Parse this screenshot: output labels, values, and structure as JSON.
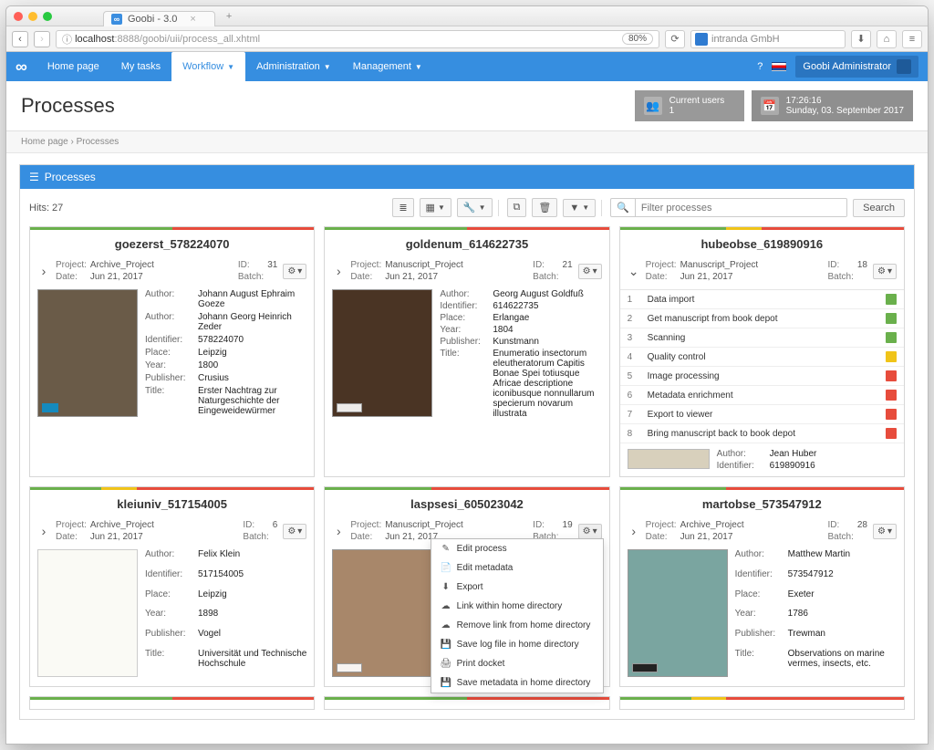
{
  "window": {
    "tab_title": "Goobi - 3.0",
    "url_host": "localhost",
    "url_port": ":8888",
    "url_path": "/goobi/uii/process_all.xhtml",
    "zoom": "80%",
    "browser_search": "intranda GmbH"
  },
  "nav": {
    "home": "Home page",
    "tasks": "My tasks",
    "workflow": "Workflow",
    "admin": "Administration",
    "mgmt": "Management",
    "help": "?",
    "user": "Goobi Administrator"
  },
  "header": {
    "title": "Processes",
    "users_label": "Current users",
    "users_count": "1",
    "time": "17:26:16",
    "date": "Sunday, 03. September 2017"
  },
  "breadcrumb": {
    "home": "Home page",
    "sep": "›",
    "current": "Processes"
  },
  "panel_title": "Processes",
  "hits": "Hits: 27",
  "filter_placeholder": "Filter processes",
  "search_btn": "Search",
  "labels": {
    "project": "Project:",
    "date": "Date:",
    "id": "ID:",
    "batch": "Batch:",
    "author": "Author:",
    "identifier": "Identifier:",
    "place": "Place:",
    "year": "Year:",
    "publisher": "Publisher:",
    "title": "Title:"
  },
  "dropdown": {
    "edit_process": "Edit process",
    "edit_metadata": "Edit metadata",
    "export": "Export",
    "link_home": "Link within home directory",
    "remove_link": "Remove link from home directory",
    "save_log": "Save log file in home directory",
    "print_docket": "Print docket",
    "save_meta": "Save metadata in home directory"
  },
  "cards": {
    "c1": {
      "title": "goezerst_578224070",
      "project": "Archive_Project",
      "date": "Jun 21, 2017",
      "id": "31",
      "batch": "",
      "author1": "Johann August Ephraim Goeze",
      "author2": "Johann Georg Heinrich Zeder",
      "identifier": "578224070",
      "place": "Leipzig",
      "year": "1800",
      "publisher": "Crusius",
      "titlev": "Erster Nachtrag zur Naturgeschichte der Eingeweidewürmer",
      "stripe": [
        "#6ab04c",
        "#6ab04c",
        "#6ab04c",
        "#6ab04c",
        "#e74c3c",
        "#e74c3c",
        "#e74c3c",
        "#e74c3c"
      ]
    },
    "c2": {
      "title": "goldenum_614622735",
      "project": "Manuscript_Project",
      "date": "Jun 21, 2017",
      "id": "21",
      "batch": "",
      "author": "Georg August Goldfuß",
      "identifier": "614622735",
      "place": "Erlangae",
      "year": "1804",
      "publisher": "Kunstmann",
      "titlev": "Enumeratio insectorum eleutheratorum Capitis Bonae Spei totiusque Africae descriptione iconibusque nonnullarum specierum novarum illustrata",
      "stripe": [
        "#6ab04c",
        "#6ab04c",
        "#6ab04c",
        "#6ab04c",
        "#e74c3c",
        "#e74c3c",
        "#e74c3c",
        "#e74c3c"
      ]
    },
    "c3": {
      "title": "hubeobse_619890916",
      "project": "Manuscript_Project",
      "date": "Jun 21, 2017",
      "id": "18",
      "batch": "",
      "steps": [
        {
          "n": "1",
          "name": "Data import",
          "s": "green"
        },
        {
          "n": "2",
          "name": "Get manuscript from book depot",
          "s": "green"
        },
        {
          "n": "3",
          "name": "Scanning",
          "s": "green"
        },
        {
          "n": "4",
          "name": "Quality control",
          "s": "yellow"
        },
        {
          "n": "5",
          "name": "Image processing",
          "s": "red"
        },
        {
          "n": "6",
          "name": "Metadata enrichment",
          "s": "red"
        },
        {
          "n": "7",
          "name": "Export to viewer",
          "s": "red"
        },
        {
          "n": "8",
          "name": "Bring manuscript back to book depot",
          "s": "red"
        }
      ],
      "author": "Jean Huber",
      "identifier": "619890916",
      "stripe": [
        "#6ab04c",
        "#6ab04c",
        "#6ab04c",
        "#f0c419",
        "#e74c3c",
        "#e74c3c",
        "#e74c3c",
        "#e74c3c"
      ]
    },
    "c4": {
      "title": "kleiuniv_517154005",
      "project": "Archive_Project",
      "date": "Jun 21, 2017",
      "id": "6",
      "batch": "",
      "author": "Felix Klein",
      "identifier": "517154005",
      "place": "Leipzig",
      "year": "1898",
      "publisher": "Vogel",
      "titlev": "Universität und Technische Hochschule",
      "stripe": [
        "#6ab04c",
        "#6ab04c",
        "#f0c419",
        "#e74c3c",
        "#e74c3c",
        "#e74c3c",
        "#e74c3c",
        "#e74c3c"
      ]
    },
    "c5": {
      "title": "laspsesi_605023042",
      "project": "Manuscript_Project",
      "date": "Jun 21, 2017",
      "id": "19",
      "batch": "",
      "stripe": [
        "#6ab04c",
        "#6ab04c",
        "#6ab04c",
        "#e74c3c",
        "#e74c3c",
        "#e74c3c",
        "#e74c3c",
        "#e74c3c"
      ]
    },
    "c6": {
      "title": "martobse_573547912",
      "project": "Archive_Project",
      "date": "Jun 21, 2017",
      "id": "28",
      "batch": "",
      "author": "Matthew Martin",
      "identifier": "573547912",
      "place": "Exeter",
      "year": "1786",
      "publisher": "Trewman",
      "titlev": "Observations on marine vermes, insects, etc.",
      "stripe": [
        "#6ab04c",
        "#6ab04c",
        "#6ab04c",
        "#e74c3c",
        "#e74c3c",
        "#e74c3c",
        "#e74c3c",
        "#e74c3c"
      ]
    }
  }
}
